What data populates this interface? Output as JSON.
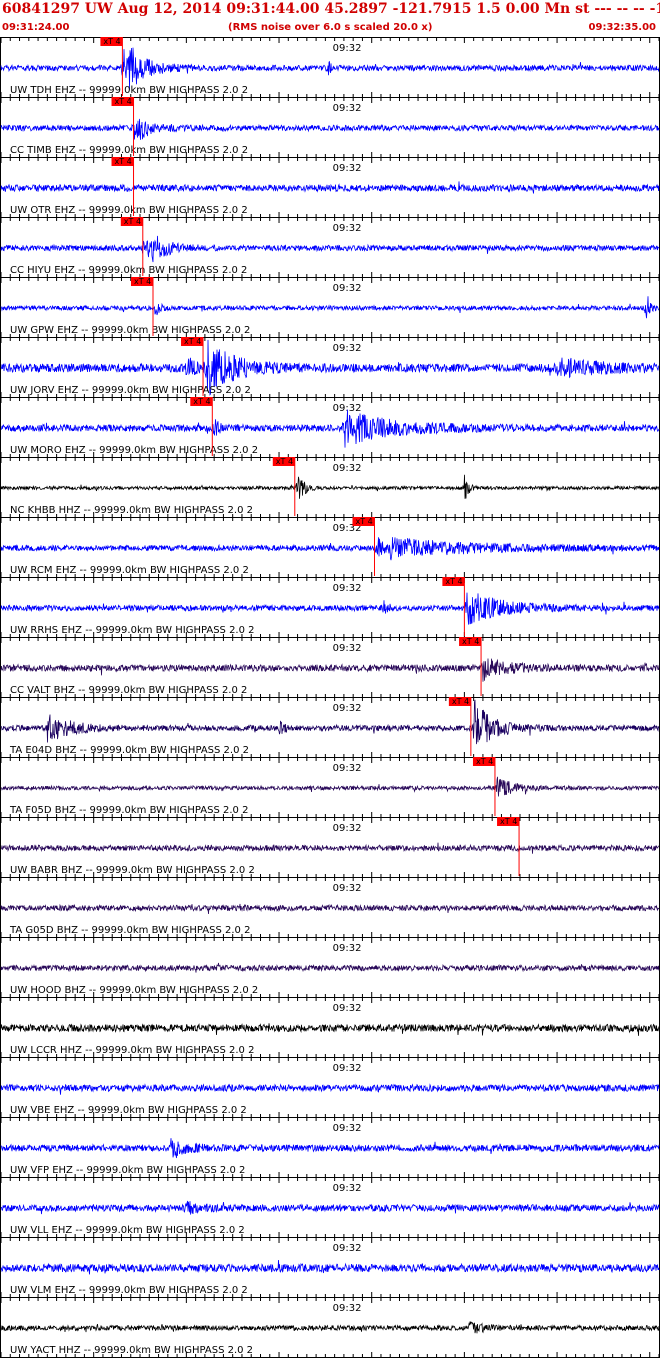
{
  "header": {
    "title": "60841297 UW Aug 12, 2014 09:31:44.00   45.2897 -121.7915  1.5 0.00 Mn st --- -- --  -1",
    "start_time": "09:31:24.00",
    "note": "(RMS noise over 6.0 s scaled 20.0 x)",
    "end_time": "09:32:35.00"
  },
  "chart_data": {
    "type": "line",
    "x_start": "09:31:24.00",
    "x_end": "09:32:35.00",
    "xlim": [
      0,
      71
    ],
    "minute_mark": {
      "label": "09:32",
      "t": 36
    },
    "pick_label": "xT 4",
    "series": [
      {
        "name": "UW TDH EHZ -- 99999.0km BW  HIGHPASS  2.0  2",
        "color": "#0000ff",
        "pick": 13.1,
        "bursts": [
          [
            13.2,
            1.6,
            1.0
          ],
          [
            13.8,
            5.0,
            0.5
          ],
          [
            35.3,
            0.6,
            0.25
          ]
        ],
        "noise": 0.1
      },
      {
        "name": "CC TIMB EHZ -- 99999.0km BW  HIGHPASS  2.0  2",
        "color": "#0000ff",
        "pick": 14.3,
        "bursts": [
          [
            14.4,
            1.5,
            0.45
          ],
          [
            15.0,
            5.0,
            0.2
          ]
        ],
        "noise": 0.1
      },
      {
        "name": "UW OTR EHZ -- 99999.0km BW  HIGHPASS  2.0  2",
        "color": "#0000ff",
        "pick": 14.3,
        "bursts": [],
        "noise": 0.12
      },
      {
        "name": "CC HIYU EHZ -- 99999.0km BW  HIGHPASS  2.0  2",
        "color": "#0000ff",
        "pick": 15.3,
        "bursts": [
          [
            15.4,
            1.2,
            0.7
          ],
          [
            16.3,
            4.0,
            0.4
          ]
        ],
        "noise": 0.1
      },
      {
        "name": "UW GPW EHZ -- 99999.0km BW  HIGHPASS  2.0  2",
        "color": "#0000ff",
        "pick": 16.4,
        "bursts": [
          [
            16.6,
            1.0,
            0.3
          ],
          [
            69.6,
            0.6,
            0.8
          ]
        ],
        "noise": 0.08
      },
      {
        "name": "UW JORV EHZ -- 99999.0km BW  HIGHPASS  2.0  2",
        "color": "#0000ff",
        "pick": 21.8,
        "bursts": [
          [
            20.0,
            3.0,
            0.35
          ],
          [
            22.2,
            6.0,
            0.9
          ],
          [
            60.0,
            10.0,
            0.3
          ]
        ],
        "noise": 0.15
      },
      {
        "name": "UW MORO EHZ -- 99999.0km BW  HIGHPASS  2.0  2",
        "color": "#0000ff",
        "pick": 22.8,
        "bursts": [
          [
            23.0,
            1.0,
            0.35
          ],
          [
            37.0,
            11.0,
            0.6
          ]
        ],
        "noise": 0.12
      },
      {
        "name": "NC KHBB HHZ -- 99999.0km BW  HIGHPASS  2.0  2",
        "color": "#000000",
        "pick": 31.7,
        "bursts": [
          [
            32.0,
            1.2,
            0.7
          ],
          [
            50.0,
            0.8,
            0.6
          ]
        ],
        "noise": 0.06
      },
      {
        "name": "UW RCM EHZ -- 99999.0km BW  HIGHPASS  2.0  2",
        "color": "#0000ff",
        "pick": 40.3,
        "bursts": [
          [
            40.6,
            1.5,
            0.4
          ],
          [
            42.0,
            20.0,
            0.3
          ]
        ],
        "noise": 0.1
      },
      {
        "name": "UW RRHS EHZ -- 99999.0km BW  HIGHPASS  2.0  2",
        "color": "#0000ff",
        "pick": 50.0,
        "bursts": [
          [
            50.2,
            8.0,
            0.6
          ],
          [
            41.3,
            0.8,
            0.3
          ]
        ],
        "noise": 0.1
      },
      {
        "name": "CC VALT BHZ -- 99999.0km BW  HIGHPASS  2.0  2",
        "color": "#2a0a5a",
        "pick": 51.8,
        "bursts": [
          [
            52.0,
            5.0,
            0.4
          ]
        ],
        "noise": 0.12
      },
      {
        "name": "TA E04D BHZ -- 99999.0km BW  HIGHPASS  2.0  2",
        "color": "#1a0060",
        "pick": 50.7,
        "bursts": [
          [
            5.0,
            5.0,
            0.5
          ],
          [
            51.0,
            4.0,
            1.0
          ],
          [
            30.0,
            1.0,
            0.3
          ]
        ],
        "noise": 0.1
      },
      {
        "name": "TA F05D BHZ -- 99999.0km BW  HIGHPASS  2.0  2",
        "color": "#2a0a5a",
        "pick": 53.3,
        "bursts": [
          [
            53.5,
            4.0,
            0.35
          ]
        ],
        "noise": 0.07
      },
      {
        "name": "UW BABR BHZ -- 99999.0km BW  HIGHPASS  2.0  2",
        "color": "#2a0a5a",
        "pick": 55.9,
        "bursts": [],
        "noise": 0.1
      },
      {
        "name": "TA G05D BHZ -- 99999.0km BW  HIGHPASS  2.0  2",
        "color": "#2a0a5a",
        "pick": null,
        "bursts": [],
        "noise": 0.1
      },
      {
        "name": "UW HOOD BHZ -- 99999.0km BW  HIGHPASS  2.0  2",
        "color": "#2a0a5a",
        "pick": null,
        "bursts": [],
        "noise": 0.1
      },
      {
        "name": "UW LCCR HHZ -- 99999.0km BW  HIGHPASS  2.0  2",
        "color": "#000000",
        "pick": null,
        "bursts": [],
        "noise": 0.13
      },
      {
        "name": "UW VBE EHZ -- 99999.0km BW  HIGHPASS  2.0  2",
        "color": "#0000ff",
        "pick": null,
        "bursts": [],
        "noise": 0.12
      },
      {
        "name": "UW VFP EHZ -- 99999.0km BW  HIGHPASS  2.0  2",
        "color": "#0000ff",
        "pick": null,
        "bursts": [
          [
            18.5,
            3.0,
            0.35
          ]
        ],
        "noise": 0.12
      },
      {
        "name": "UW VLL EHZ -- 99999.0km BW  HIGHPASS  2.0  2",
        "color": "#0000ff",
        "pick": null,
        "bursts": [
          [
            20.0,
            3.0,
            0.2
          ]
        ],
        "noise": 0.12
      },
      {
        "name": "UW VLM EHZ -- 99999.0km BW  HIGHPASS  2.0  2",
        "color": "#0000ff",
        "pick": null,
        "bursts": [],
        "noise": 0.14
      },
      {
        "name": "UW YACT HHZ -- 99999.0km BW  HIGHPASS  2.0  2",
        "color": "#000000",
        "pick": null,
        "bursts": [
          [
            50.5,
            3.0,
            0.2
          ]
        ],
        "noise": 0.09
      }
    ]
  }
}
